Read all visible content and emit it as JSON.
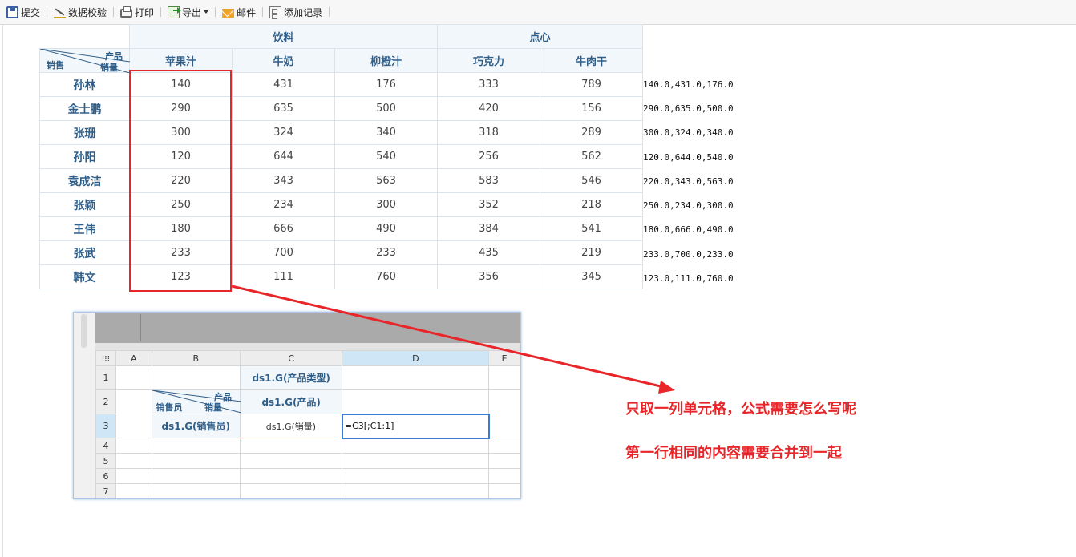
{
  "toolbar": {
    "submit": "提交",
    "validate": "数据校验",
    "print": "打印",
    "export": "导出",
    "mail": "邮件",
    "add_record": "添加记录"
  },
  "report": {
    "groups": [
      "饮料",
      "点心"
    ],
    "corner": {
      "product": "产品",
      "quantity": "销量",
      "sales": "销售"
    },
    "products": [
      "苹果汁",
      "牛奶",
      "柳橙汁",
      "巧克力",
      "牛肉干"
    ],
    "rows": [
      {
        "name": "孙林",
        "values": [
          "140",
          "431",
          "176",
          "333",
          "789"
        ],
        "side": "140.0,431.0,176.0"
      },
      {
        "name": "金士鹏",
        "values": [
          "290",
          "635",
          "500",
          "420",
          "156"
        ],
        "side": "290.0,635.0,500.0"
      },
      {
        "name": "张珊",
        "values": [
          "300",
          "324",
          "340",
          "318",
          "289"
        ],
        "side": "300.0,324.0,340.0"
      },
      {
        "name": "孙阳",
        "values": [
          "120",
          "644",
          "540",
          "256",
          "562"
        ],
        "side": "120.0,644.0,540.0"
      },
      {
        "name": "袁成洁",
        "values": [
          "220",
          "343",
          "563",
          "583",
          "546"
        ],
        "side": "220.0,343.0,563.0"
      },
      {
        "name": "张颖",
        "values": [
          "250",
          "234",
          "300",
          "352",
          "218"
        ],
        "side": "250.0,234.0,300.0"
      },
      {
        "name": "王伟",
        "values": [
          "180",
          "666",
          "490",
          "384",
          "541"
        ],
        "side": "180.0,666.0,490.0"
      },
      {
        "name": "张武",
        "values": [
          "233",
          "700",
          "233",
          "435",
          "219"
        ],
        "side": "233.0,700.0,233.0"
      },
      {
        "name": "韩文",
        "values": [
          "123",
          "111",
          "760",
          "356",
          "345"
        ],
        "side": "123.0,111.0,760.0"
      }
    ]
  },
  "designer": {
    "grid_icon": "⁝⁝⁝",
    "columns": [
      "A",
      "B",
      "C",
      "D",
      "E"
    ],
    "rows": [
      "1",
      "2",
      "3",
      "4",
      "5",
      "6",
      "7"
    ],
    "c1": "ds1.G(产品类型)",
    "c2": "ds1.G(产品)",
    "b2_product": "产品",
    "b2_quantity": "销量",
    "b2_salesman": "销售员",
    "b3": "ds1.G(销售员)",
    "c3": "ds1.G(销量)",
    "d3": "=C3[;C1:1]"
  },
  "annotations": {
    "line1": "只取一列单元格，公式需要怎么写呢",
    "line2": "第一行相同的内容需要合并到一起"
  }
}
